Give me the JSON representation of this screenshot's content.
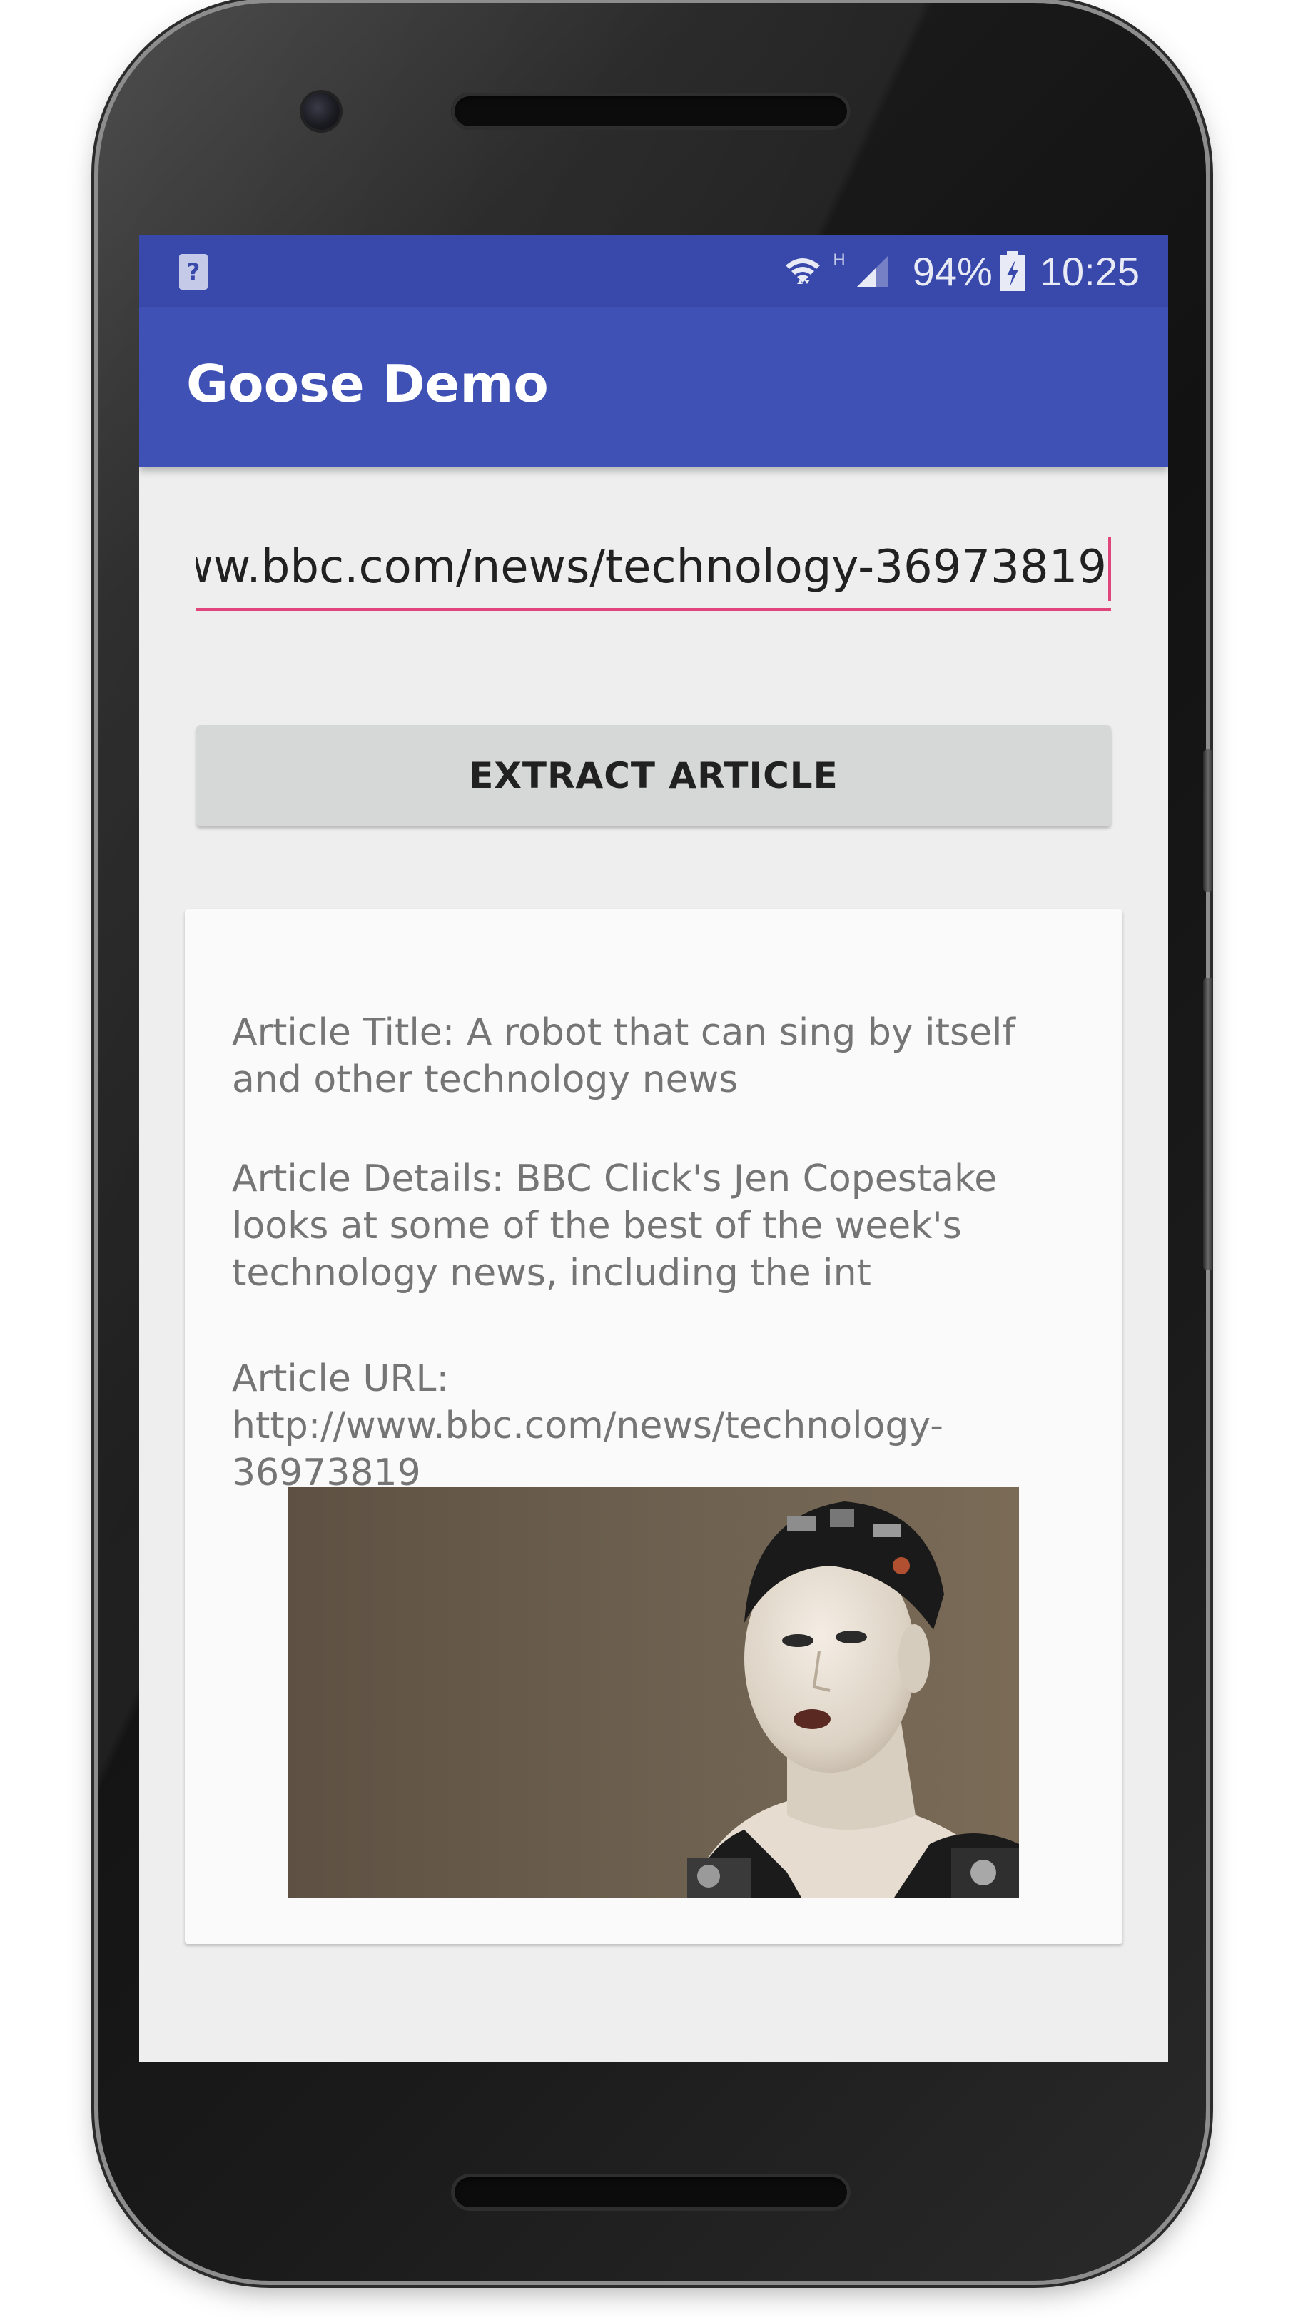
{
  "status_bar": {
    "left_icon_glyph": "?",
    "network_type": "H",
    "battery_percent": "94%",
    "time": "10:25",
    "icons": [
      "unknown-notification-icon",
      "wifi-icon",
      "signal-icon",
      "battery-charging-icon"
    ]
  },
  "app_bar": {
    "title": "Goose Demo",
    "color": "#3f51b5",
    "status_color": "#3949ab"
  },
  "form": {
    "url_value": "ww.bbc.com/news/technology-36973819",
    "accent_color": "#e0457b",
    "extract_button_label": "EXTRACT ARTICLE"
  },
  "article": {
    "title_line": "Article Title: A robot that can sing by itself and other technology news",
    "details_line": "Article Details: BBC Click's Jen Copestake looks at some of the best of the week's technology news, including the int",
    "url_line": "Article URL: http://www.bbc.com/news/technology-36973819",
    "image_subject": "android-robot-image"
  }
}
